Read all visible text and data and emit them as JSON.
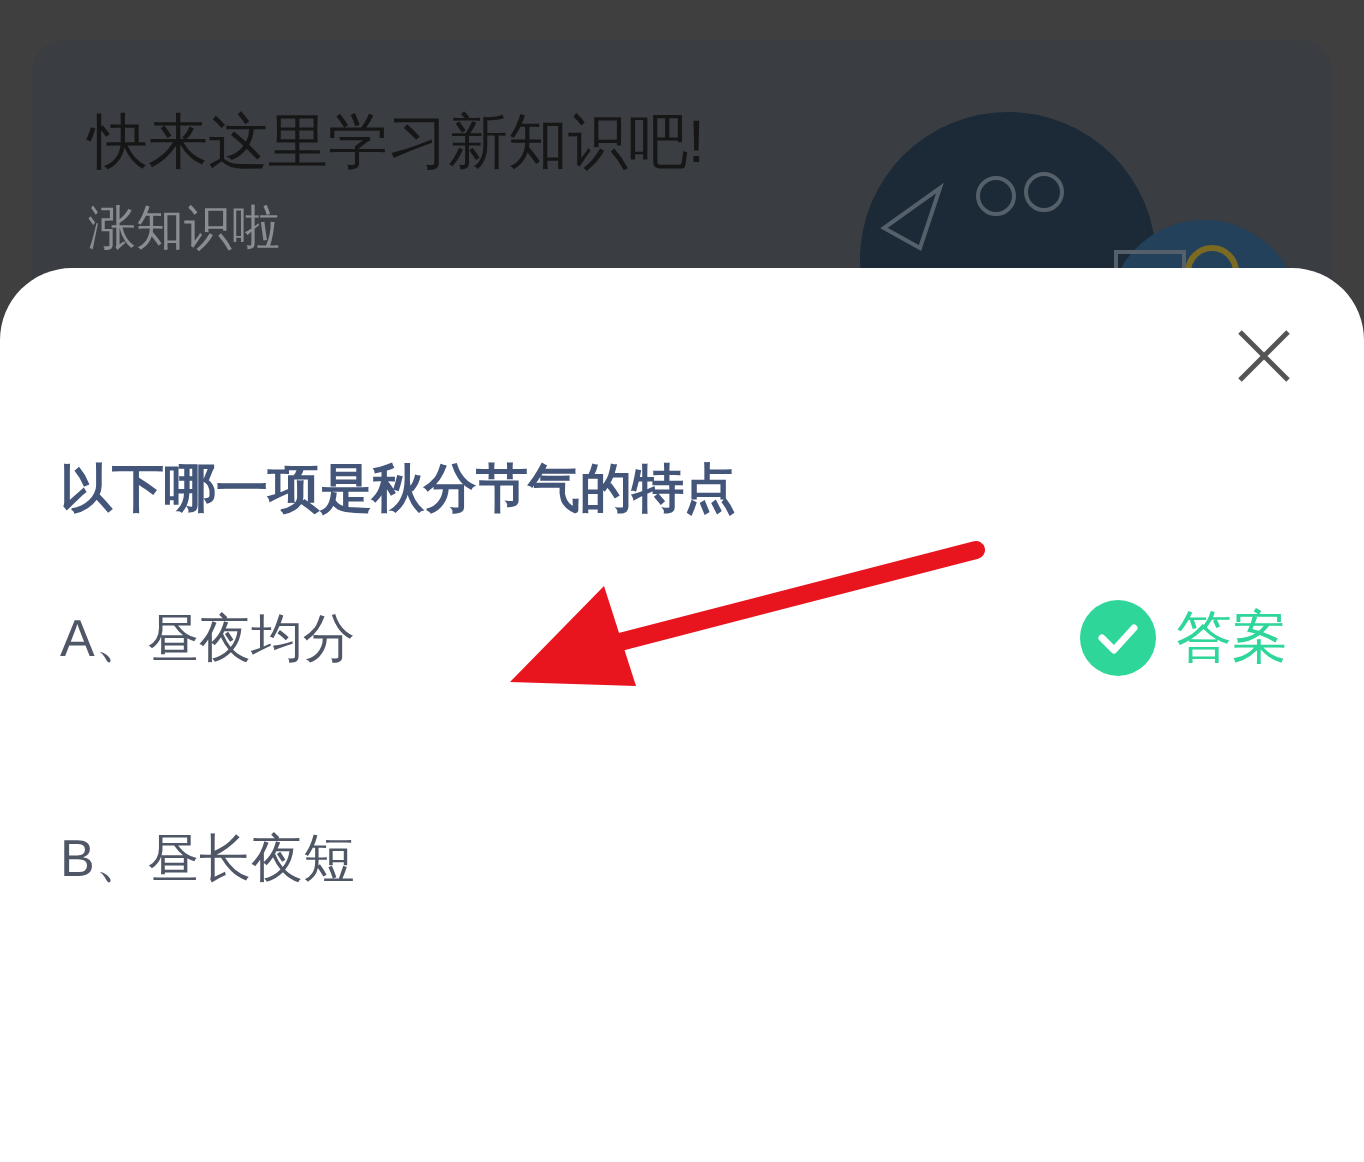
{
  "banner": {
    "title": "快来这里学习新知识吧!",
    "subtitle": "涨知识啦"
  },
  "sheet": {
    "question": "以下哪一项是秋分节气的特点",
    "options": [
      {
        "label": "A、昼夜均分",
        "marked": true,
        "badge": "答案"
      },
      {
        "label": "B、昼长夜短",
        "marked": false
      }
    ]
  }
}
